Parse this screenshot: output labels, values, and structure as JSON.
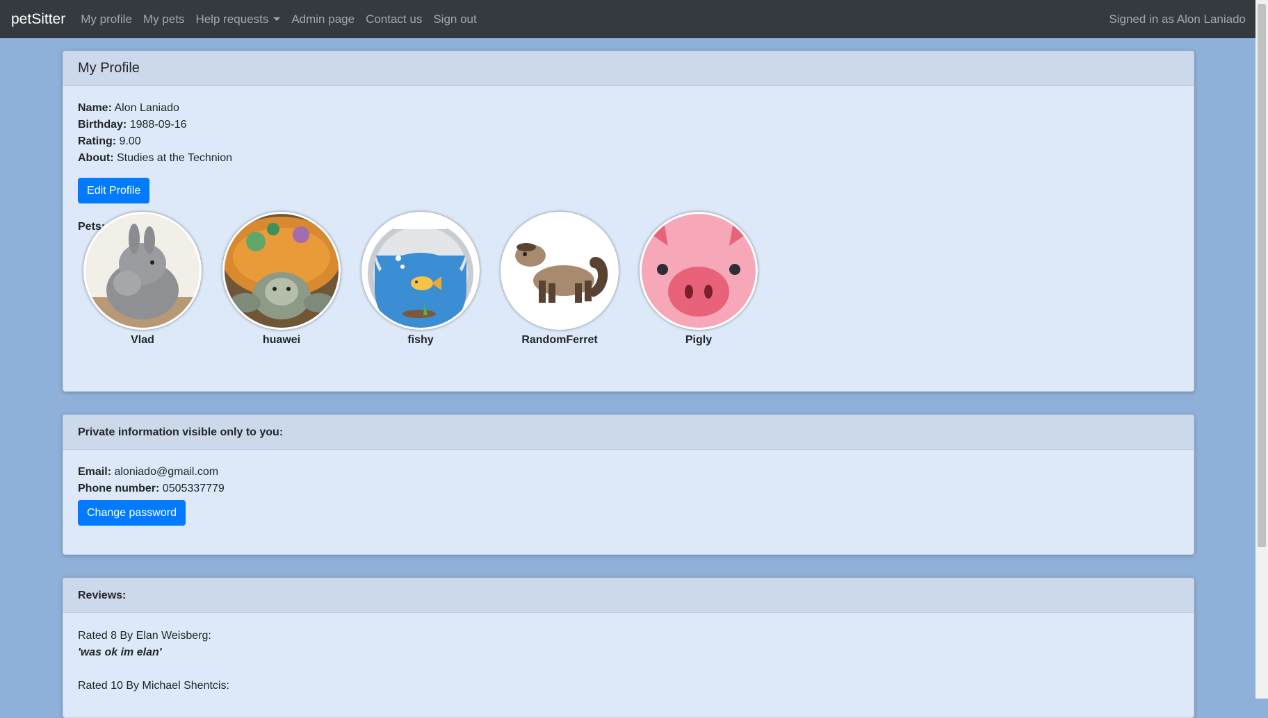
{
  "nav": {
    "brand": "petSitter",
    "links": [
      "My profile",
      "My pets",
      "Help requests",
      "Admin page",
      "Contact us",
      "Sign out"
    ],
    "signed_in": "Signed in as Alon Laniado"
  },
  "profile": {
    "title": "My Profile",
    "fields": [
      {
        "label": "Name:",
        "value": "Alon Laniado"
      },
      {
        "label": "Birthday:",
        "value": "1988-09-16"
      },
      {
        "label": "Rating:",
        "value": "9.00"
      },
      {
        "label": "About:",
        "value": "Studies at the Technion"
      }
    ],
    "edit_button": "Edit Profile",
    "pets_label": "Pets:",
    "pets": [
      {
        "name": "Vlad",
        "icon": "rabbit-photo"
      },
      {
        "name": "huawei",
        "icon": "turtle-photo"
      },
      {
        "name": "fishy",
        "icon": "fishbowl-icon"
      },
      {
        "name": "RandomFerret",
        "icon": "ferret-icon"
      },
      {
        "name": "Pigly",
        "icon": "pig-icon"
      }
    ]
  },
  "private": {
    "title": "Private information visible only to you:",
    "fields": [
      {
        "label": "Email:",
        "value": "aloniado@gmail.com"
      },
      {
        "label": "Phone number:",
        "value": "0505337779"
      }
    ],
    "change_password_button": "Change password"
  },
  "reviews": {
    "title": "Reviews:",
    "items": [
      {
        "header": "Rated 8 By Elan Weisberg:",
        "text": "'was ok im elan'"
      },
      {
        "header": "Rated 10 By Michael Shentcis:",
        "text": ""
      }
    ]
  },
  "colors": {
    "navbar": "#343a40",
    "page_background": "#8fb0d8",
    "card_body": "#dde9f8",
    "card_header": "#ccd9ea",
    "primary_button": "#007bff"
  }
}
